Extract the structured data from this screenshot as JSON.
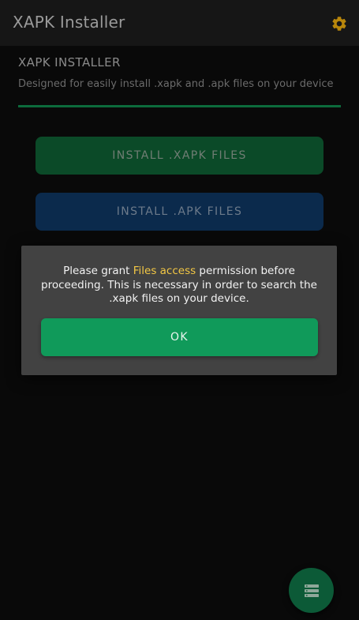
{
  "app_bar": {
    "title": "XAPK Installer",
    "settings_icon": "gear-icon"
  },
  "header": {
    "title": "XAPK INSTALLER",
    "description": "Designed for easily install .xapk and .apk files on your device"
  },
  "buttons": {
    "install_xapk": "INSTALL .XAPK FILES",
    "install_apk": "INSTALL .APK FILES"
  },
  "dialog": {
    "message_before": "Please grant ",
    "message_highlight": "Files access",
    "message_after": " permission before proceeding. This is necessary in order to search the .xapk files on your device.",
    "ok_label": "OK"
  },
  "fab": {
    "icon": "list-icon"
  },
  "colors": {
    "accent_green": "#109a5a",
    "highlight_yellow": "#f2c744",
    "gear": "#b8860b",
    "xapk_button": "#0b4a28",
    "apk_button": "#0b2a4c"
  }
}
